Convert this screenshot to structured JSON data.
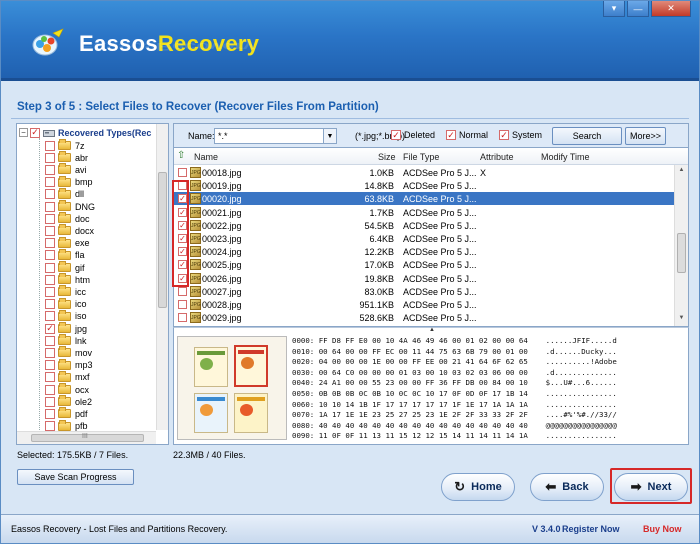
{
  "window": {
    "title_prefix": "Eassos",
    "title_accent": "Recovery",
    "minimize": "▾",
    "restore": "—",
    "close": "✕"
  },
  "step_title": "Step 3 of 5 : Select Files to Recover (Recover Files From Partition)",
  "tree": {
    "root_label": "Recovered Types(Rec",
    "items": [
      {
        "label": "7z",
        "checked": false
      },
      {
        "label": "abr",
        "checked": false
      },
      {
        "label": "avi",
        "checked": false
      },
      {
        "label": "bmp",
        "checked": false
      },
      {
        "label": "dll",
        "checked": false
      },
      {
        "label": "DNG",
        "checked": false
      },
      {
        "label": "doc",
        "checked": false
      },
      {
        "label": "docx",
        "checked": false
      },
      {
        "label": "exe",
        "checked": false
      },
      {
        "label": "fla",
        "checked": false
      },
      {
        "label": "gif",
        "checked": false
      },
      {
        "label": "htm",
        "checked": false
      },
      {
        "label": "icc",
        "checked": false
      },
      {
        "label": "ico",
        "checked": false
      },
      {
        "label": "iso",
        "checked": false
      },
      {
        "label": "jpg",
        "checked": true
      },
      {
        "label": "lnk",
        "checked": false
      },
      {
        "label": "mov",
        "checked": false
      },
      {
        "label": "mp3",
        "checked": false
      },
      {
        "label": "mxf",
        "checked": false
      },
      {
        "label": "ocx",
        "checked": false
      },
      {
        "label": "ole2",
        "checked": false
      },
      {
        "label": "pdf",
        "checked": false
      },
      {
        "label": "pfb",
        "checked": false
      }
    ],
    "hscroll_grip": "III"
  },
  "filter": {
    "name_label": "Name:",
    "name_value": "*.*",
    "hint": "(*.jpg;*.bmp)",
    "deleted_label": "Deleted",
    "normal_label": "Normal",
    "system_label": "System",
    "search_button": "Search",
    "more_button": "More>>"
  },
  "columns": {
    "name": "Name",
    "size": "Size",
    "type": "File Type",
    "attribute": "Attribute",
    "modify": "Modify Time"
  },
  "files": [
    {
      "name": "00018.jpg",
      "size": "1.0KB",
      "type": "ACDSee Pro 5 J...",
      "attr": "X",
      "checked": false,
      "selected": false
    },
    {
      "name": "00019.jpg",
      "size": "14.8KB",
      "type": "ACDSee Pro 5 J...",
      "attr": "",
      "checked": false,
      "selected": false
    },
    {
      "name": "00020.jpg",
      "size": "63.8KB",
      "type": "ACDSee Pro 5 J...",
      "attr": "",
      "checked": true,
      "selected": true
    },
    {
      "name": "00021.jpg",
      "size": "1.7KB",
      "type": "ACDSee Pro 5 J...",
      "attr": "",
      "checked": true,
      "selected": false
    },
    {
      "name": "00022.jpg",
      "size": "54.5KB",
      "type": "ACDSee Pro 5 J...",
      "attr": "",
      "checked": true,
      "selected": false
    },
    {
      "name": "00023.jpg",
      "size": "6.4KB",
      "type": "ACDSee Pro 5 J...",
      "attr": "",
      "checked": true,
      "selected": false
    },
    {
      "name": "00024.jpg",
      "size": "12.2KB",
      "type": "ACDSee Pro 5 J...",
      "attr": "",
      "checked": true,
      "selected": false
    },
    {
      "name": "00025.jpg",
      "size": "17.0KB",
      "type": "ACDSee Pro 5 J...",
      "attr": "",
      "checked": true,
      "selected": false
    },
    {
      "name": "00026.jpg",
      "size": "19.8KB",
      "type": "ACDSee Pro 5 J...",
      "attr": "",
      "checked": true,
      "selected": false
    },
    {
      "name": "00027.jpg",
      "size": "83.0KB",
      "type": "ACDSee Pro 5 J...",
      "attr": "",
      "checked": false,
      "selected": false
    },
    {
      "name": "00028.jpg",
      "size": "951.1KB",
      "type": "ACDSee Pro 5 J...",
      "attr": "",
      "checked": false,
      "selected": false
    },
    {
      "name": "00029.jpg",
      "size": "528.6KB",
      "type": "ACDSee Pro 5 J...",
      "attr": "",
      "checked": false,
      "selected": false
    }
  ],
  "hex_lines": [
    "0000: FF D8 FF E0 00 10 4A 46 49 46 00 01 02 00 00 64    ......JFIF.....d",
    "0010: 00 64 00 00 FF EC 00 11 44 75 63 6B 79 00 01 00    .d......Ducky...",
    "0020: 04 00 00 00 1E 00 00 FF EE 00 21 41 64 6F 62 65    ..........!Adobe",
    "0030: 00 64 C0 00 00 00 01 03 00 10 03 02 03 06 00 00    .d..............",
    "0040: 24 A1 00 00 55 23 00 00 FF 36 FF DB 00 84 00 10    $...U#...6......",
    "0050: 0B 0B 0B 0C 0B 10 0C 0C 10 17 0F 0D 0F 17 1B 14    ................",
    "0060: 10 10 14 1B 1F 17 17 17 17 17 1F 1E 17 1A 1A 1A    ................",
    "0070: 1A 17 1E 1E 23 25 27 25 23 1E 2F 2F 33 33 2F 2F    ....#%'%#.//33//",
    "0080: 40 40 40 40 40 40 40 40 40 40 40 40 40 40 40 40    @@@@@@@@@@@@@@@@",
    "0090: 11 0F 0F 11 13 11 15 12 12 15 14 11 14 11 14 1A    ................"
  ],
  "status": {
    "selected": "Selected: 175.5KB / 7 Files.",
    "total": "22.3MB / 40 Files."
  },
  "buttons": {
    "save_scan": "Save Scan Progress",
    "home": "Home",
    "back": "Back",
    "next": "Next"
  },
  "footer": {
    "tagline": "Eassos Recovery - Lost Files and Partitions Recovery.",
    "version": "V 3.4.0",
    "register": "Register Now",
    "buy": "Buy Now"
  },
  "colors": {
    "header": "#2a74c6",
    "accent": "#f2e21a",
    "selection": "#3a75c4",
    "highlight_frame": "#d62828",
    "step_title": "#1b5fb0"
  }
}
